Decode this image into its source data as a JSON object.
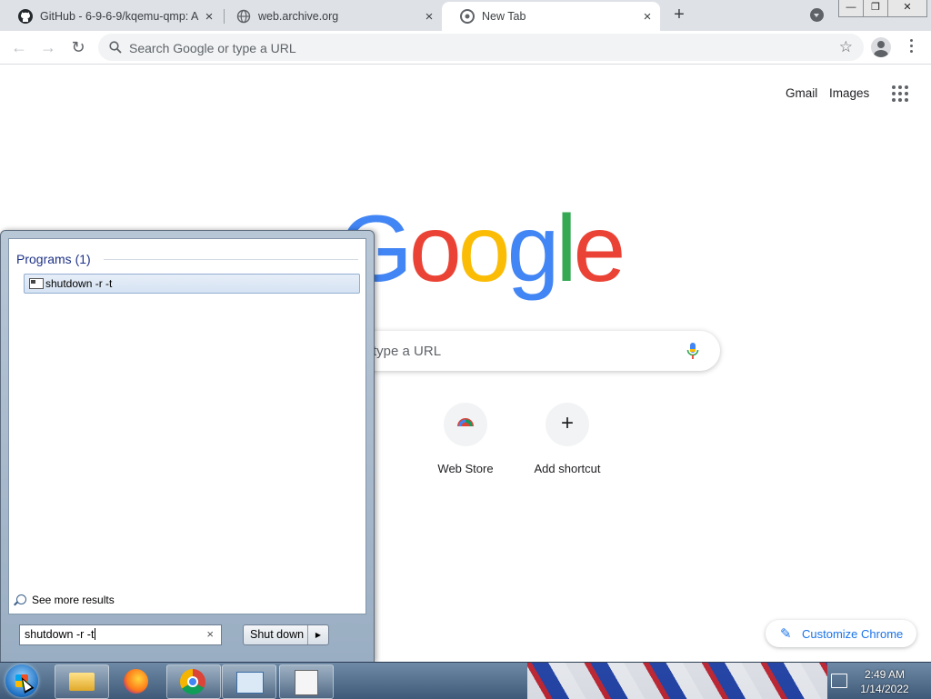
{
  "browser": {
    "tabs": [
      {
        "title": "GitHub - 6-9-6-9/kqemu-qmp: A",
        "favicon": "github-icon",
        "active": false
      },
      {
        "title": "web.archive.org",
        "favicon": "globe-icon",
        "active": false
      },
      {
        "title": "New Tab",
        "favicon": "chrome-icon",
        "active": true
      }
    ],
    "new_tab_label": "+",
    "window_controls": [
      "—",
      "❐",
      "✕"
    ]
  },
  "toolbar": {
    "back_icon": "←",
    "forward_icon": "→",
    "reload_icon": "↻",
    "omnibox_placeholder": "Search Google or type a URL",
    "star_icon": "☆"
  },
  "ntp": {
    "links": {
      "gmail": "Gmail",
      "images": "Images"
    },
    "logo_letters": [
      {
        "ch": "G",
        "color": "#4285f4"
      },
      {
        "ch": "o",
        "color": "#ea4335"
      },
      {
        "ch": "o",
        "color": "#fbbc05"
      },
      {
        "ch": "g",
        "color": "#4285f4"
      },
      {
        "ch": "l",
        "color": "#34a853"
      },
      {
        "ch": "e",
        "color": "#ea4335"
      }
    ],
    "search_placeholder_visible": "type a URL",
    "shortcuts": [
      {
        "label": "Web Store",
        "icon": "web-store-icon"
      },
      {
        "label": "Add shortcut",
        "icon": "plus-icon",
        "glyph": "+"
      }
    ],
    "customize_label": "Customize Chrome",
    "customize_icon": "✎"
  },
  "start_menu": {
    "heading": "Programs (1)",
    "results": [
      {
        "label": "shutdown -r -t",
        "icon": "console-icon"
      }
    ],
    "see_more": "See more results",
    "search_value": "shutdown -r -t",
    "clear_icon": "×",
    "shutdown_label": "Shut down",
    "shutdown_arrow": "▶"
  },
  "taskbar": {
    "apps": [
      "explorer-icon",
      "firefox-icon",
      "chrome-icon",
      "control-panel-icon",
      "task-list-icon"
    ],
    "clock_time": "2:49 AM",
    "clock_date": "1/14/2022"
  },
  "colors": {
    "accent": "#1a73e8",
    "tabstrip": "#dee1e6",
    "start_heading": "#1e3287"
  }
}
